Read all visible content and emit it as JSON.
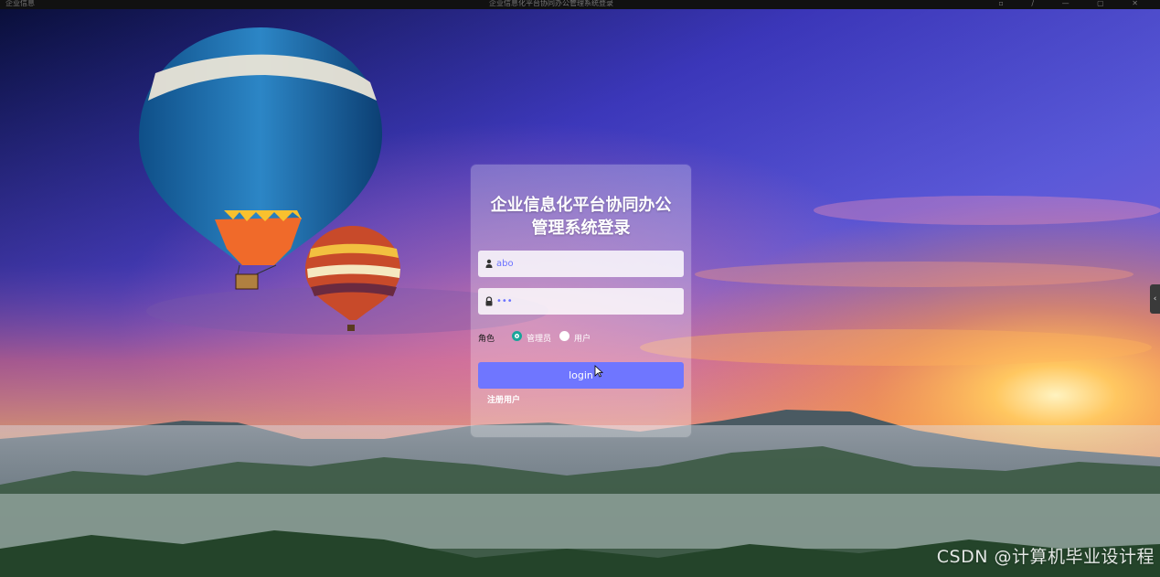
{
  "browser": {
    "left_text": "企业信息",
    "title_text": "企业信息化平台协同办公管理系统登录",
    "right_icons": [
      "panel-icon",
      "pen-icon",
      "minimize-icon",
      "maximize-icon",
      "close-icon"
    ]
  },
  "login": {
    "title_line1": "企业信息化平台协同办公",
    "title_line2": "管理系统登录",
    "username_value": "abo",
    "password_value": "•••",
    "role_label": "角色",
    "roles": [
      {
        "label": "管理员",
        "checked": true
      },
      {
        "label": "用户",
        "checked": false
      }
    ],
    "login_button": "login",
    "register_link": "注册用户"
  },
  "side_tab": "‹",
  "watermark": "CSDN @计算机毕业设计程",
  "colors": {
    "button": "#6f76ff",
    "input_text": "#6a72ff",
    "radio_checked": "#1aa59a"
  }
}
